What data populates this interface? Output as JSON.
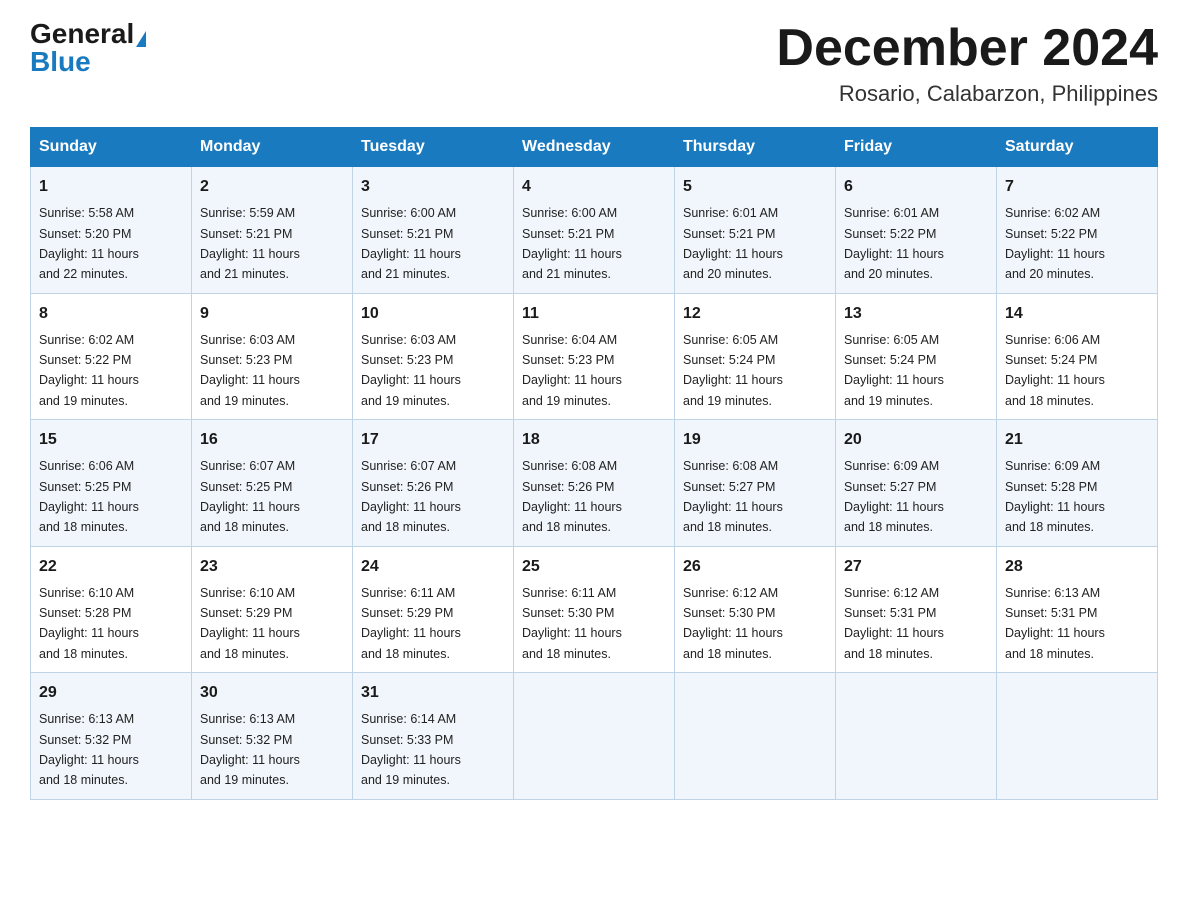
{
  "header": {
    "logo_general": "General",
    "logo_blue": "Blue",
    "month_title": "December 2024",
    "location": "Rosario, Calabarzon, Philippines"
  },
  "days_of_week": [
    "Sunday",
    "Monday",
    "Tuesday",
    "Wednesday",
    "Thursday",
    "Friday",
    "Saturday"
  ],
  "weeks": [
    [
      {
        "day": "1",
        "sunrise": "5:58 AM",
        "sunset": "5:20 PM",
        "daylight": "11 hours and 22 minutes."
      },
      {
        "day": "2",
        "sunrise": "5:59 AM",
        "sunset": "5:21 PM",
        "daylight": "11 hours and 21 minutes."
      },
      {
        "day": "3",
        "sunrise": "6:00 AM",
        "sunset": "5:21 PM",
        "daylight": "11 hours and 21 minutes."
      },
      {
        "day": "4",
        "sunrise": "6:00 AM",
        "sunset": "5:21 PM",
        "daylight": "11 hours and 21 minutes."
      },
      {
        "day": "5",
        "sunrise": "6:01 AM",
        "sunset": "5:21 PM",
        "daylight": "11 hours and 20 minutes."
      },
      {
        "day": "6",
        "sunrise": "6:01 AM",
        "sunset": "5:22 PM",
        "daylight": "11 hours and 20 minutes."
      },
      {
        "day": "7",
        "sunrise": "6:02 AM",
        "sunset": "5:22 PM",
        "daylight": "11 hours and 20 minutes."
      }
    ],
    [
      {
        "day": "8",
        "sunrise": "6:02 AM",
        "sunset": "5:22 PM",
        "daylight": "11 hours and 19 minutes."
      },
      {
        "day": "9",
        "sunrise": "6:03 AM",
        "sunset": "5:23 PM",
        "daylight": "11 hours and 19 minutes."
      },
      {
        "day": "10",
        "sunrise": "6:03 AM",
        "sunset": "5:23 PM",
        "daylight": "11 hours and 19 minutes."
      },
      {
        "day": "11",
        "sunrise": "6:04 AM",
        "sunset": "5:23 PM",
        "daylight": "11 hours and 19 minutes."
      },
      {
        "day": "12",
        "sunrise": "6:05 AM",
        "sunset": "5:24 PM",
        "daylight": "11 hours and 19 minutes."
      },
      {
        "day": "13",
        "sunrise": "6:05 AM",
        "sunset": "5:24 PM",
        "daylight": "11 hours and 19 minutes."
      },
      {
        "day": "14",
        "sunrise": "6:06 AM",
        "sunset": "5:24 PM",
        "daylight": "11 hours and 18 minutes."
      }
    ],
    [
      {
        "day": "15",
        "sunrise": "6:06 AM",
        "sunset": "5:25 PM",
        "daylight": "11 hours and 18 minutes."
      },
      {
        "day": "16",
        "sunrise": "6:07 AM",
        "sunset": "5:25 PM",
        "daylight": "11 hours and 18 minutes."
      },
      {
        "day": "17",
        "sunrise": "6:07 AM",
        "sunset": "5:26 PM",
        "daylight": "11 hours and 18 minutes."
      },
      {
        "day": "18",
        "sunrise": "6:08 AM",
        "sunset": "5:26 PM",
        "daylight": "11 hours and 18 minutes."
      },
      {
        "day": "19",
        "sunrise": "6:08 AM",
        "sunset": "5:27 PM",
        "daylight": "11 hours and 18 minutes."
      },
      {
        "day": "20",
        "sunrise": "6:09 AM",
        "sunset": "5:27 PM",
        "daylight": "11 hours and 18 minutes."
      },
      {
        "day": "21",
        "sunrise": "6:09 AM",
        "sunset": "5:28 PM",
        "daylight": "11 hours and 18 minutes."
      }
    ],
    [
      {
        "day": "22",
        "sunrise": "6:10 AM",
        "sunset": "5:28 PM",
        "daylight": "11 hours and 18 minutes."
      },
      {
        "day": "23",
        "sunrise": "6:10 AM",
        "sunset": "5:29 PM",
        "daylight": "11 hours and 18 minutes."
      },
      {
        "day": "24",
        "sunrise": "6:11 AM",
        "sunset": "5:29 PM",
        "daylight": "11 hours and 18 minutes."
      },
      {
        "day": "25",
        "sunrise": "6:11 AM",
        "sunset": "5:30 PM",
        "daylight": "11 hours and 18 minutes."
      },
      {
        "day": "26",
        "sunrise": "6:12 AM",
        "sunset": "5:30 PM",
        "daylight": "11 hours and 18 minutes."
      },
      {
        "day": "27",
        "sunrise": "6:12 AM",
        "sunset": "5:31 PM",
        "daylight": "11 hours and 18 minutes."
      },
      {
        "day": "28",
        "sunrise": "6:13 AM",
        "sunset": "5:31 PM",
        "daylight": "11 hours and 18 minutes."
      }
    ],
    [
      {
        "day": "29",
        "sunrise": "6:13 AM",
        "sunset": "5:32 PM",
        "daylight": "11 hours and 18 minutes."
      },
      {
        "day": "30",
        "sunrise": "6:13 AM",
        "sunset": "5:32 PM",
        "daylight": "11 hours and 19 minutes."
      },
      {
        "day": "31",
        "sunrise": "6:14 AM",
        "sunset": "5:33 PM",
        "daylight": "11 hours and 19 minutes."
      },
      null,
      null,
      null,
      null
    ]
  ],
  "labels": {
    "sunrise": "Sunrise:",
    "sunset": "Sunset:",
    "daylight": "Daylight:"
  }
}
